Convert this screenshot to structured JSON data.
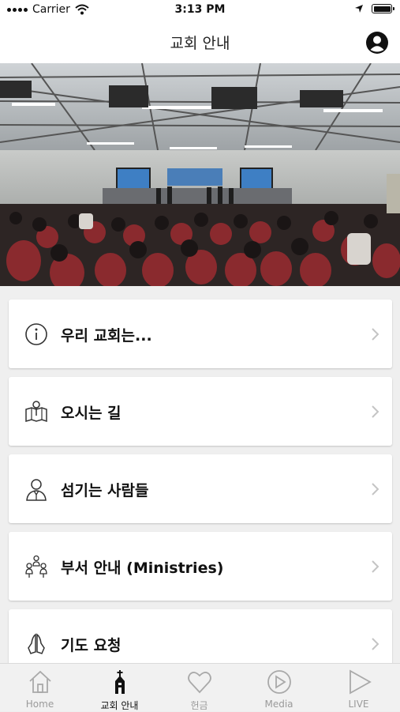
{
  "status": {
    "carrier": "Carrier",
    "time": "3:13 PM"
  },
  "header": {
    "title": "교회 안내",
    "profile_icon": "person-circle-icon"
  },
  "hero": {
    "alt": "church-congregation-photo"
  },
  "menu": [
    {
      "label": "우리 교회는...",
      "icon": "info-circle-icon"
    },
    {
      "label": "오시는 길",
      "icon": "map-pin-icon"
    },
    {
      "label": "섬기는 사람들",
      "icon": "person-suit-icon"
    },
    {
      "label": "부서 안내 (Ministries)",
      "icon": "people-group-icon"
    },
    {
      "label": "기도 요청",
      "icon": "praying-hands-icon"
    }
  ],
  "tabbar": {
    "tabs": [
      {
        "label": "Home",
        "icon": "home-icon"
      },
      {
        "label": "교회 안내",
        "icon": "church-icon",
        "active": true
      },
      {
        "label": "헌금",
        "icon": "heart-icon"
      },
      {
        "label": "Media",
        "icon": "play-circle-icon"
      },
      {
        "label": "LIVE",
        "icon": "play-triangle-icon"
      }
    ],
    "active_color": "#111111",
    "inactive_color": "#9a9a9a"
  }
}
